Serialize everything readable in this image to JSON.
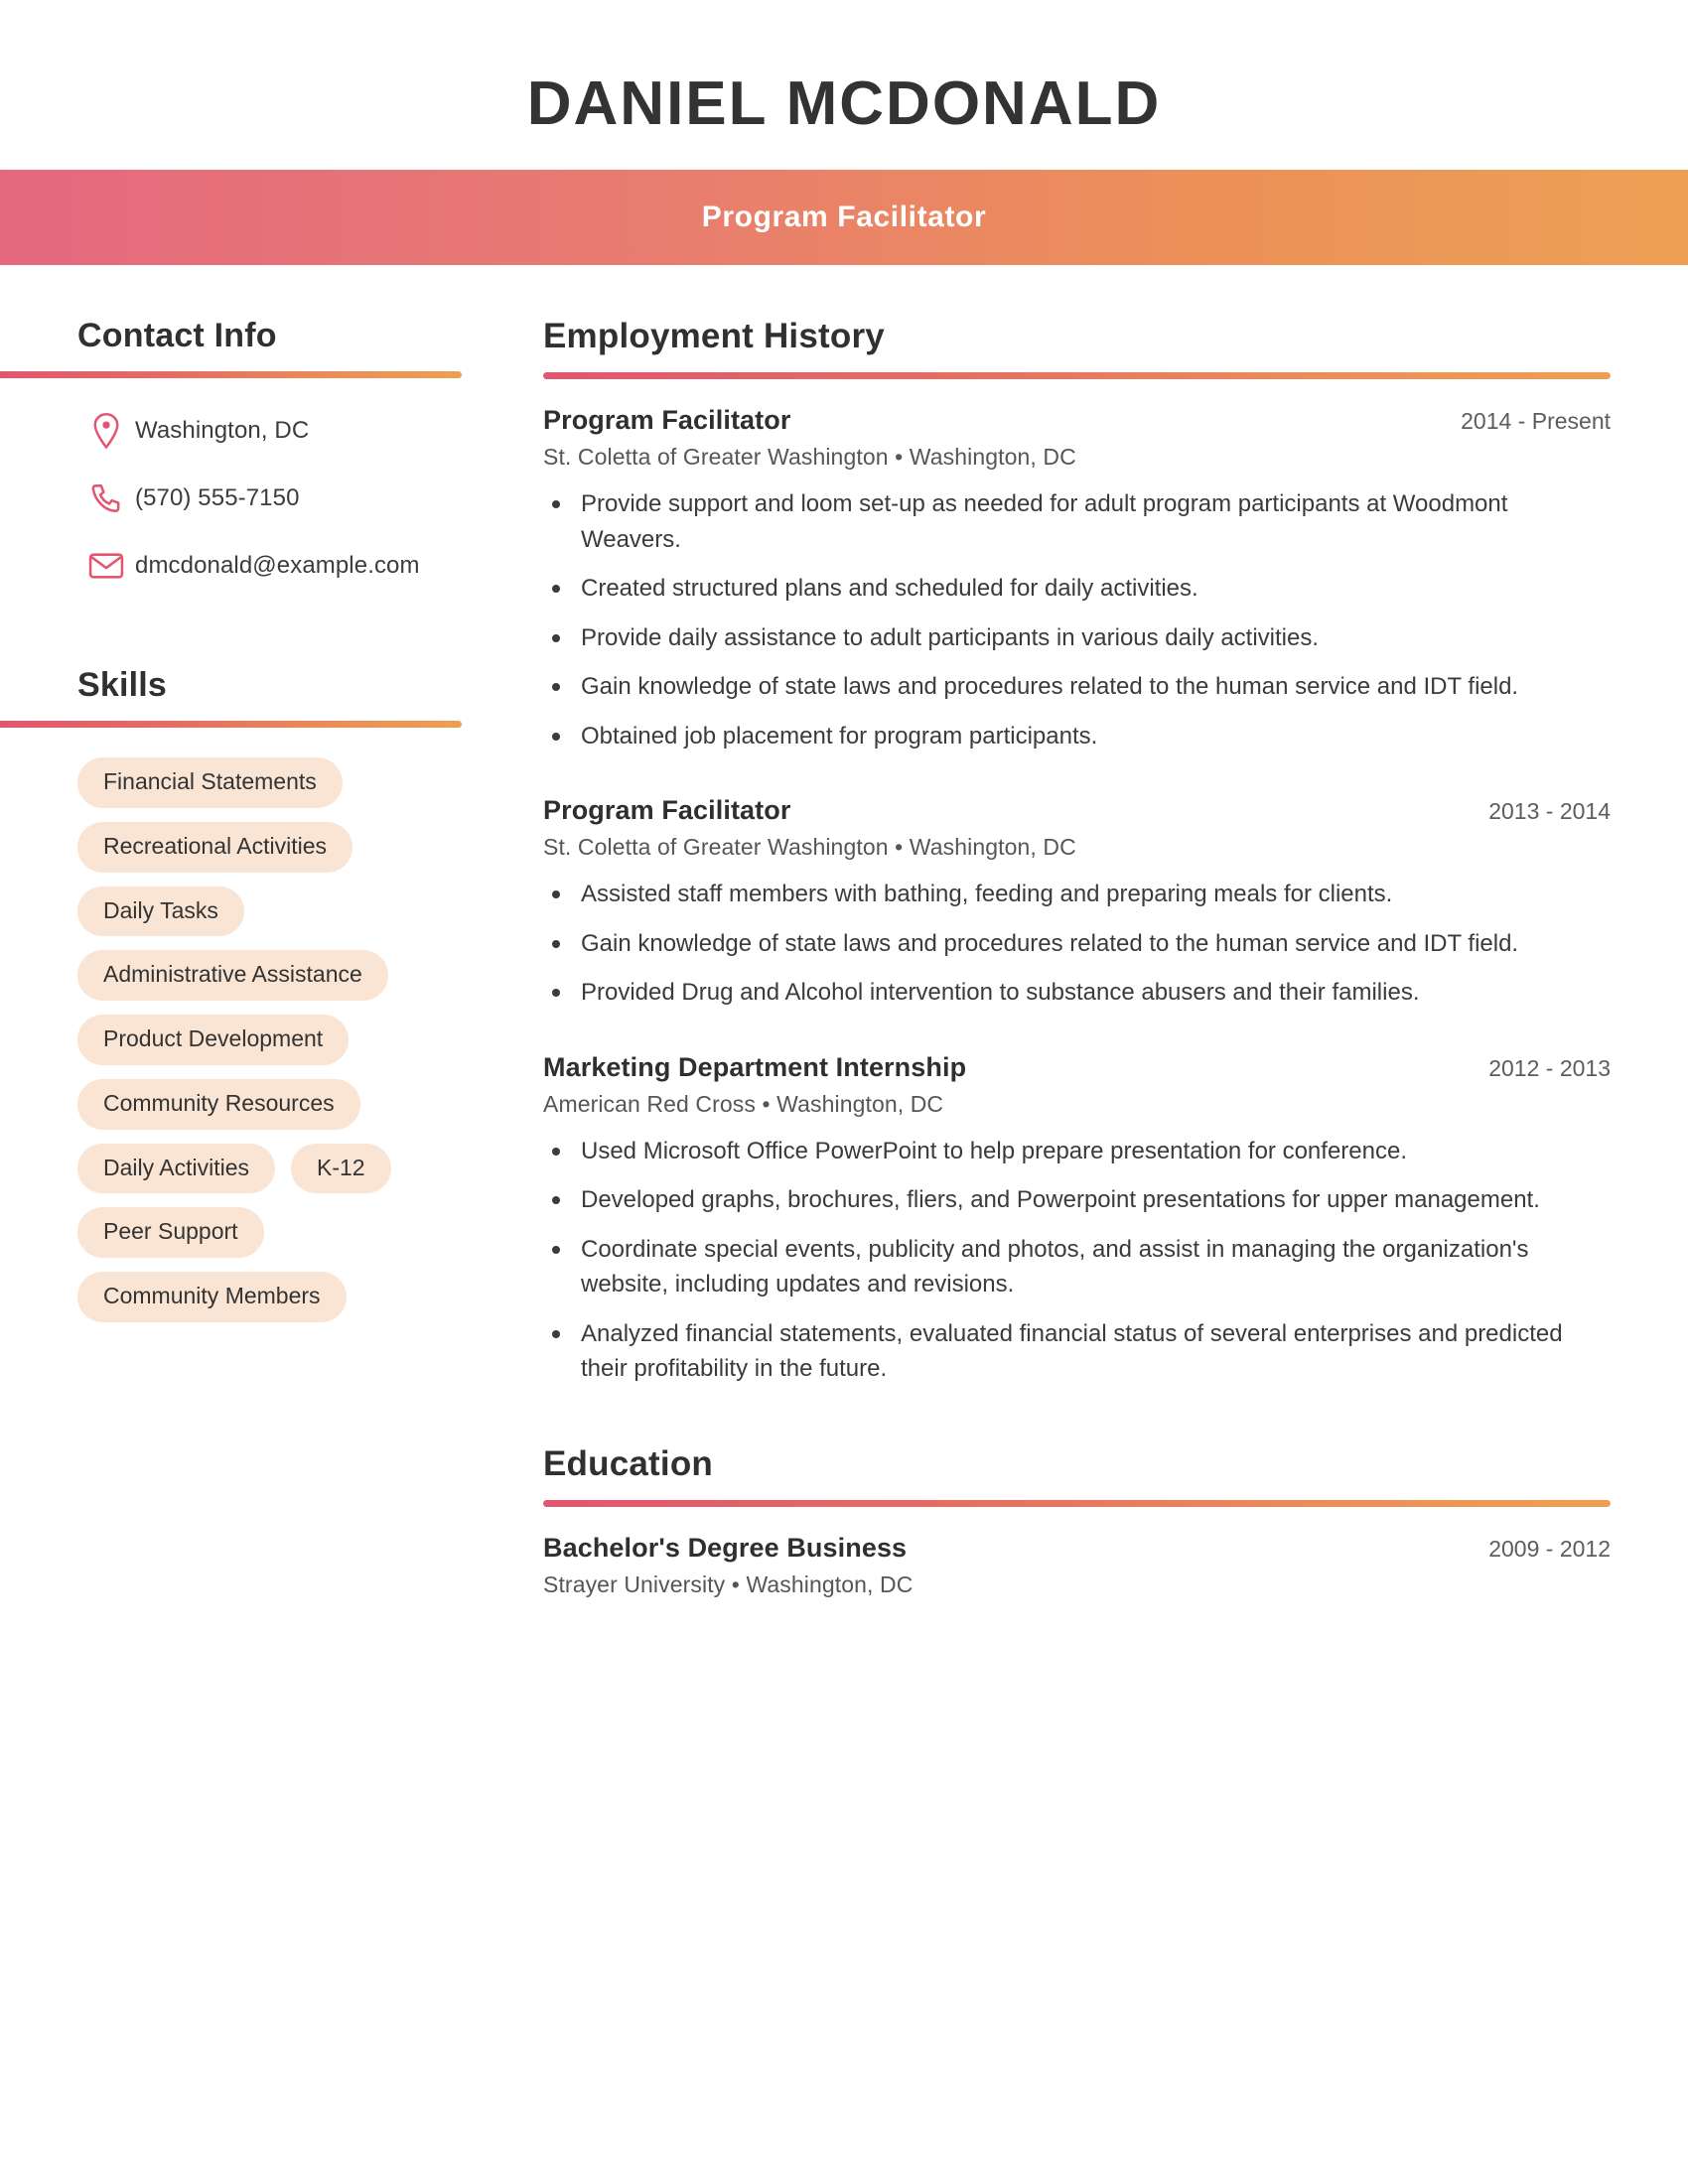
{
  "header": {
    "name": "DANIEL MCDONALD",
    "title": "Program Facilitator"
  },
  "theme": {
    "gradient_start": "#e2566f",
    "gradient_end": "#ee9f52",
    "pill_background": "#fae5d5",
    "icon_color": "#e2566f",
    "text_color": "#3b3b3b"
  },
  "sidebar": {
    "contact": {
      "heading": "Contact Info",
      "items": [
        {
          "icon": "location-pin-icon",
          "value": "Washington, DC"
        },
        {
          "icon": "phone-icon",
          "value": "(570) 555-7150"
        },
        {
          "icon": "envelope-icon",
          "value": "dmcdonald@example.com"
        }
      ]
    },
    "skills": {
      "heading": "Skills",
      "items": [
        "Financial Statements",
        "Recreational Activities",
        "Daily Tasks",
        "Administrative Assistance",
        "Product Development",
        "Community Resources",
        "Daily Activities",
        "K-12",
        "Peer Support",
        "Community Members"
      ]
    }
  },
  "main": {
    "employment": {
      "heading": "Employment History",
      "entries": [
        {
          "title": "Program Facilitator",
          "dates": "2014 - Present",
          "organization": "St. Coletta of Greater Washington",
          "location": "Washington, DC",
          "separator": "•",
          "bullets": [
            "Provide support and loom set-up as needed for adult program participants at Woodmont Weavers.",
            "Created structured plans and scheduled for daily activities.",
            "Provide daily assistance to adult participants in various daily activities.",
            "Gain knowledge of state laws and procedures related to the human service and IDT field.",
            "Obtained job placement for program participants."
          ]
        },
        {
          "title": "Program Facilitator",
          "dates": "2013 - 2014",
          "organization": "St. Coletta of Greater Washington",
          "location": "Washington, DC",
          "separator": "•",
          "bullets": [
            "Assisted staff members with bathing, feeding and preparing meals for clients.",
            "Gain knowledge of state laws and procedures related to the human service and IDT field.",
            "Provided Drug and Alcohol intervention to substance abusers and their families."
          ]
        },
        {
          "title": "Marketing Department Internship",
          "dates": "2012 - 2013",
          "organization": "American Red Cross",
          "location": "Washington, DC",
          "separator": "•",
          "bullets": [
            "Used Microsoft Office PowerPoint to help prepare presentation for conference.",
            "Developed graphs, brochures, fliers, and Powerpoint presentations for upper management.",
            "Coordinate special events, publicity and photos, and assist in managing the organization's website, including updates and revisions.",
            "Analyzed financial statements, evaluated financial status of several enterprises and predicted their profitability in the future."
          ]
        }
      ]
    },
    "education": {
      "heading": "Education",
      "entries": [
        {
          "title": "Bachelor's Degree Business",
          "dates": "2009 - 2012",
          "organization": "Strayer University",
          "location": "Washington, DC",
          "separator": "•"
        }
      ]
    }
  }
}
